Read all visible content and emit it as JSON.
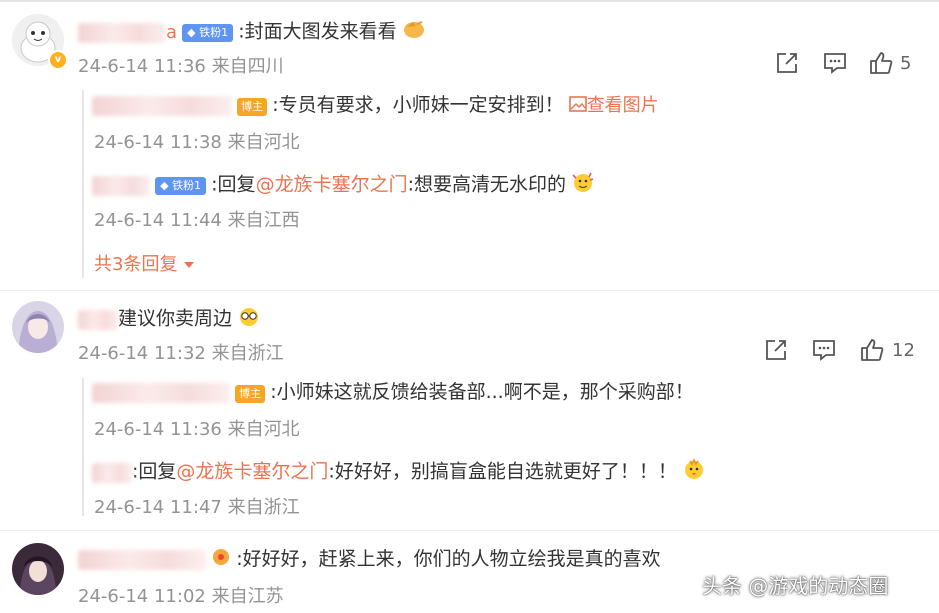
{
  "comments": [
    {
      "fan_badge": "铁粉1",
      "text": ":封面大图发来看看",
      "meta": "24-6-14 11:36 来自四川",
      "like_count": "5",
      "name_tail": "a",
      "replies": [
        {
          "badge": "博主",
          "text": ":专员有要求，小师妹一定安排到！",
          "view_image": "查看图片",
          "meta": "24-6-14 11:38 来自河北"
        },
        {
          "fan_badge": "铁粉1",
          "prefix": ":回复",
          "mention": "@龙族卡塞尔之门",
          "text": ":想要高清无水印的",
          "meta": "24-6-14 11:44 来自江西"
        }
      ],
      "more_replies": "共3条回复"
    },
    {
      "text": "建议你卖周边",
      "meta": "24-6-14 11:32 来自浙江",
      "like_count": "12",
      "replies": [
        {
          "badge": "博主",
          "text": ":小师妹这就反馈给装备部...啊不是，那个采购部！",
          "meta": "24-6-14 11:36 来自河北"
        },
        {
          "prefix": ":回复",
          "mention": "@龙族卡塞尔之门",
          "text": ":好好好，别搞盲盒能自选就更好了！！！",
          "meta": "24-6-14 11:47 来自浙江"
        }
      ]
    },
    {
      "text": ":好好好，赶紧上来，你们的人物立绘我是真的喜欢",
      "meta": "24-6-14 11:02 来自江苏"
    }
  ],
  "watermark": "头条 @游戏的动态圈",
  "icons": [
    "share-icon",
    "comment-icon",
    "like-icon",
    "v-badge-icon",
    "image-icon",
    "caret-down-icon"
  ],
  "colors": {
    "name": "#eb7350",
    "meta": "#939393",
    "fan_badge": "#5f95f0",
    "bozhu_badge": "#f5a623"
  }
}
